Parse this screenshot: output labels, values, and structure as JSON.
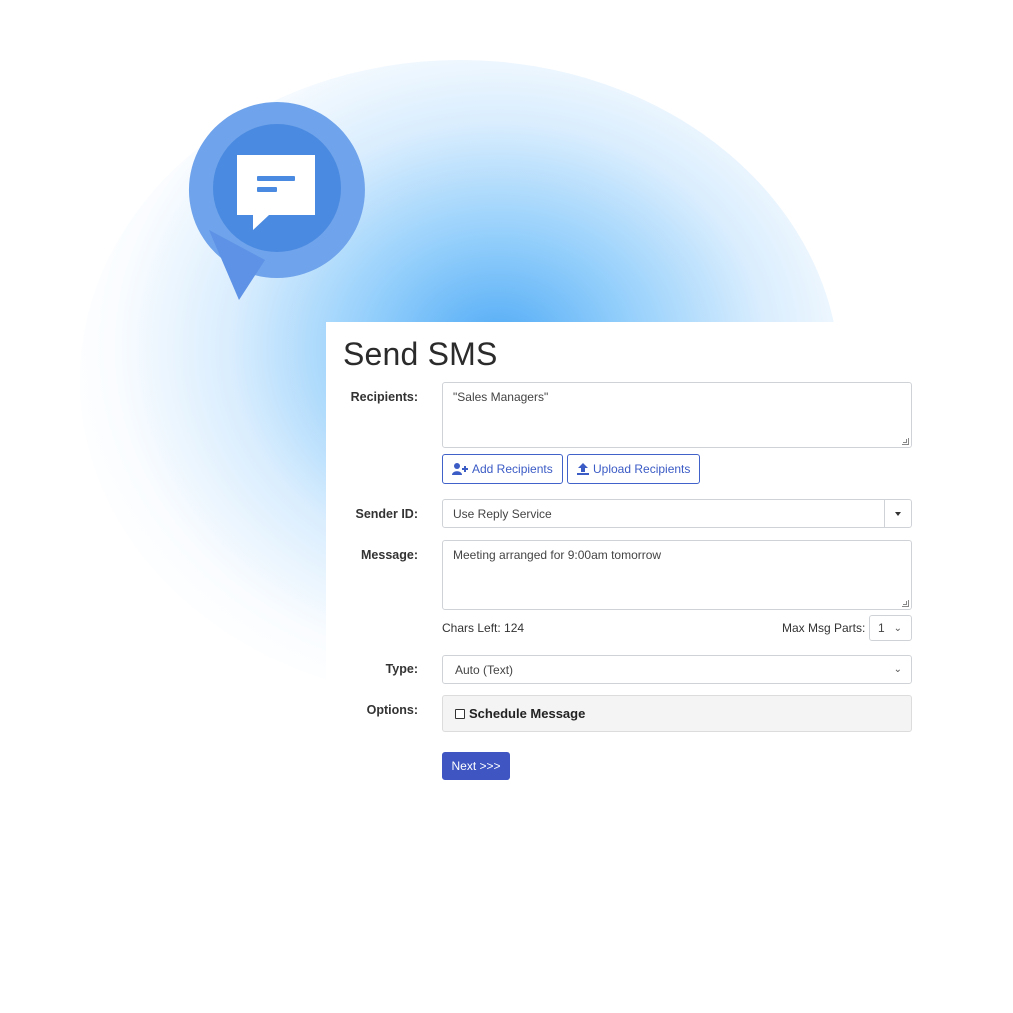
{
  "form": {
    "title": "Send SMS",
    "labels": {
      "recipients": "Recipients:",
      "sender_id": "Sender ID:",
      "message": "Message:",
      "type": "Type:",
      "options": "Options:"
    },
    "recipients_value": "\"Sales Managers\"",
    "add_recipients": "Add Recipients",
    "upload_recipients": "Upload Recipients",
    "sender_id_value": "Use Reply Service",
    "message_value": "Meeting arranged for 9:00am tomorrow",
    "chars_left": "Chars Left: 124",
    "max_msg_parts_label": "Max Msg Parts:",
    "max_msg_parts_value": "1",
    "type_value": "Auto (Text)",
    "schedule_message": "Schedule Message",
    "next_button": "Next >>>"
  },
  "icons": {
    "badge": "sms-chat-pin-icon",
    "add": "add-user-icon",
    "upload": "upload-icon"
  },
  "colors": {
    "accent": "#3e55c2",
    "pin_outer": "#6fa3eb",
    "pin_inner": "#4a8ae0"
  }
}
